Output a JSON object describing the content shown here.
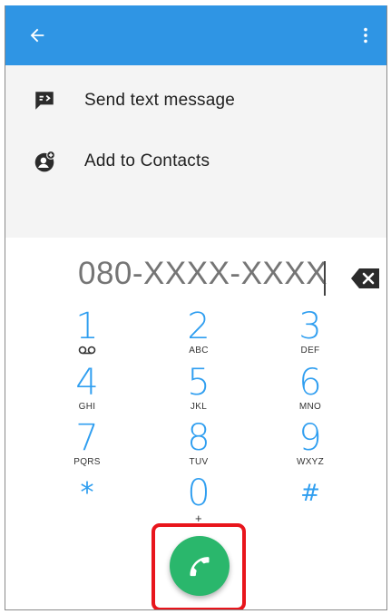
{
  "colors": {
    "appbar": "#2f95e4",
    "digit": "#2f9ef0",
    "call_button": "#2ab76c",
    "highlight": "#e8151c"
  },
  "appbar": {
    "back_icon": "arrow-left-icon",
    "menu_icon": "more-vert-icon"
  },
  "options": [
    {
      "label": "Send text message",
      "icon": "message-icon"
    },
    {
      "label": "Add to Contacts",
      "icon": "add-contact-icon"
    }
  ],
  "dialer": {
    "number": "080-XXXX-XXXX",
    "backspace_icon": "backspace-icon",
    "keys": [
      {
        "digit": "1",
        "letters": "",
        "sub_icon": "voicemail-icon"
      },
      {
        "digit": "2",
        "letters": "ABC"
      },
      {
        "digit": "3",
        "letters": "DEF"
      },
      {
        "digit": "4",
        "letters": "GHI"
      },
      {
        "digit": "5",
        "letters": "JKL"
      },
      {
        "digit": "6",
        "letters": "MNO"
      },
      {
        "digit": "7",
        "letters": "PQRS"
      },
      {
        "digit": "8",
        "letters": "TUV"
      },
      {
        "digit": "9",
        "letters": "WXYZ"
      },
      {
        "digit": "*",
        "letters": ""
      },
      {
        "digit": "0",
        "letters": "+"
      },
      {
        "digit": "#",
        "letters": ""
      }
    ],
    "call_icon": "phone-icon"
  }
}
